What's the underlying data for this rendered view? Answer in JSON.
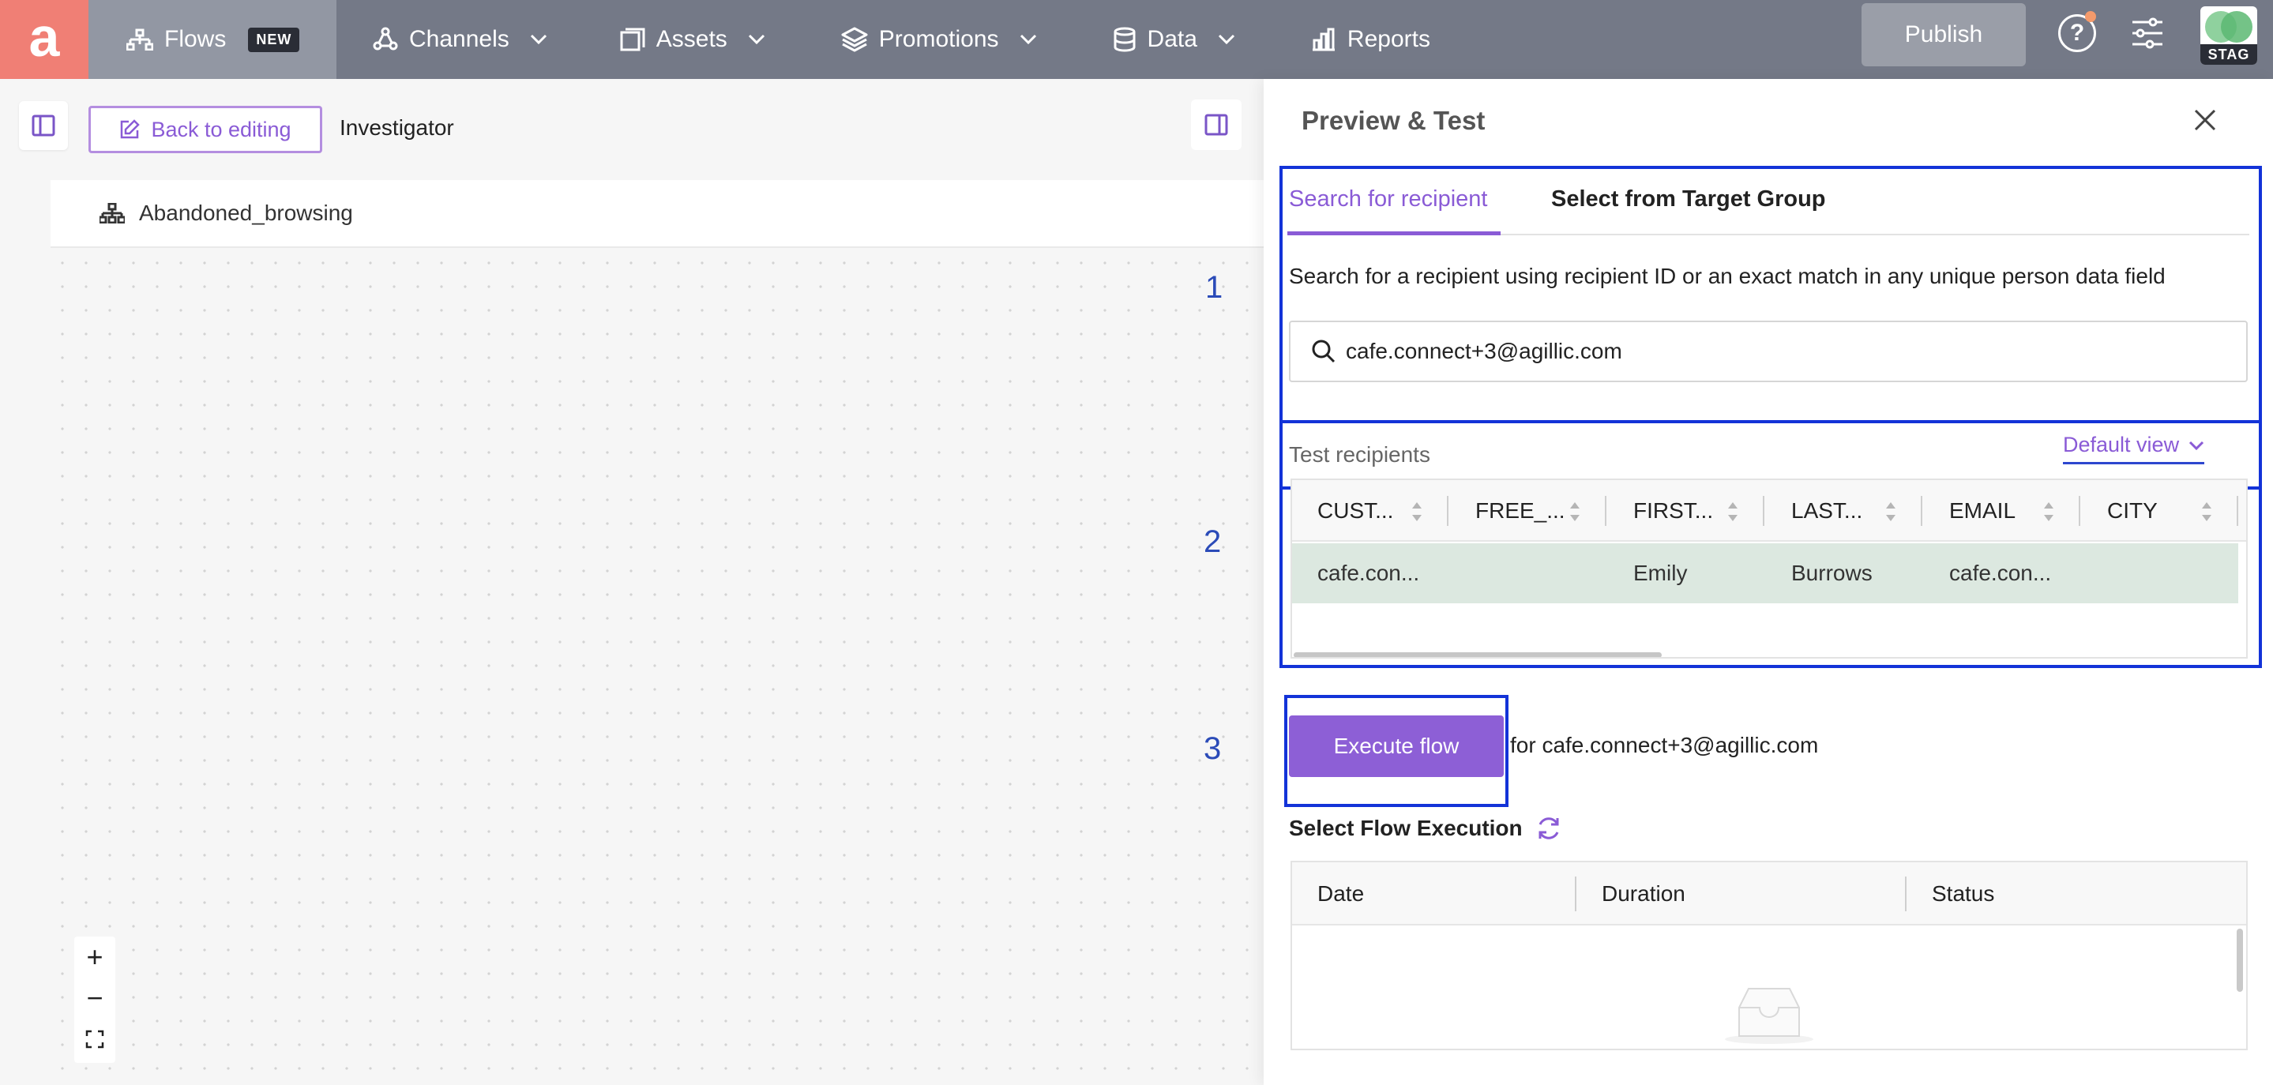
{
  "nav": {
    "logo": "a",
    "items": [
      {
        "label": "Flows",
        "badge": "NEW"
      },
      {
        "label": "Channels"
      },
      {
        "label": "Assets"
      },
      {
        "label": "Promotions"
      },
      {
        "label": "Data"
      },
      {
        "label": "Reports"
      }
    ],
    "publish_label": "Publish",
    "help_glyph": "?",
    "env_label": "STAG"
  },
  "editor": {
    "back_label": "Back to editing",
    "mode_label": "Investigator",
    "flow_name": "Abandoned_browsing",
    "steps": [
      "1",
      "2",
      "3"
    ],
    "zoom_in": "+",
    "zoom_out": "−"
  },
  "panel": {
    "title": "Preview & Test",
    "tabs": [
      "Search for recipient",
      "Select from Target Group"
    ],
    "search_help": "Search for a recipient using recipient ID or an exact match in any unique person data field",
    "search_value": "cafe.connect+3@agillic.com",
    "test_recipients_label": "Test recipients",
    "default_view_label": "Default view",
    "columns": [
      "CUST...",
      "FREE_...",
      "FIRST...",
      "LAST...",
      "EMAIL",
      "CITY"
    ],
    "rows": [
      [
        "cafe.con...",
        "",
        "Emily",
        "Burrows",
        "cafe.con...",
        ""
      ]
    ],
    "execute_label": "Execute flow",
    "execute_for": "for cafe.connect+3@agillic.com",
    "select_execution_label": "Select Flow Execution",
    "execution_columns": [
      "Date",
      "Duration",
      "Status"
    ]
  },
  "colors": {
    "accent": "#8a5bd6",
    "nav_bg": "#747987",
    "logo_bg": "#f07f75",
    "highlight": "#1333d8",
    "selected_row": "#dce8e0"
  }
}
